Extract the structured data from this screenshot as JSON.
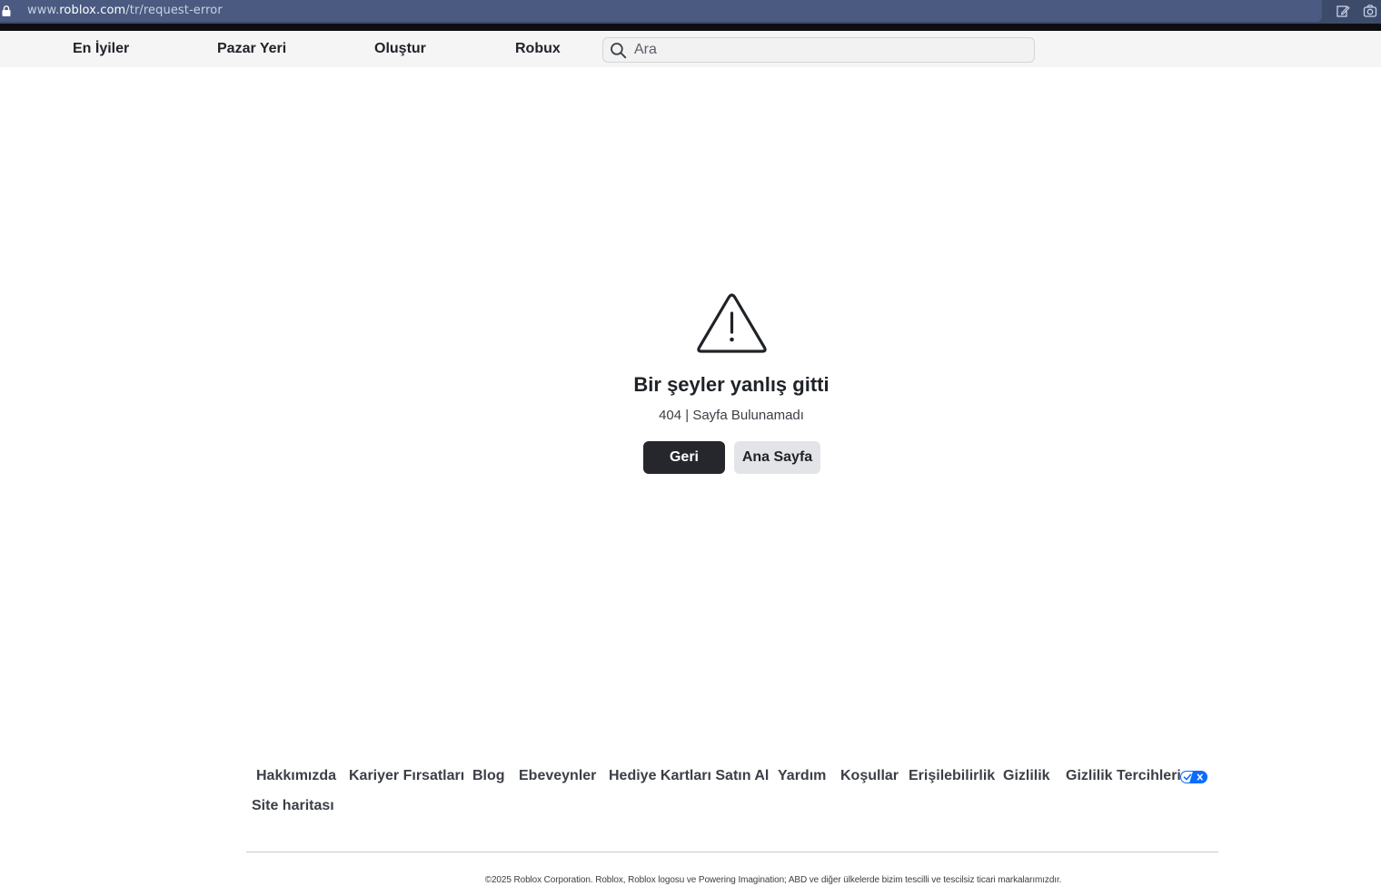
{
  "browser": {
    "url_prefix": "www.",
    "url_domain": "roblox.com",
    "url_path": "/tr/request-error"
  },
  "nav": {
    "items": [
      {
        "label": "En İyiler"
      },
      {
        "label": "Pazar Yeri"
      },
      {
        "label": "Oluştur"
      },
      {
        "label": "Robux"
      }
    ],
    "search_placeholder": "Ara"
  },
  "error": {
    "icon": "warning-triangle-icon",
    "title": "Bir şeyler yanlış gitti",
    "subtitle": "404 | Sayfa Bulunamadı",
    "back_label": "Geri",
    "home_label": "Ana Sayfa"
  },
  "footer": {
    "links": [
      {
        "label": "Hakkımızda"
      },
      {
        "label": "Kariyer Fırsatları"
      },
      {
        "label": "Blog"
      },
      {
        "label": "Ebeveynler"
      },
      {
        "label": "Hediye Kartları Satın Al"
      },
      {
        "label": "Yardım"
      },
      {
        "label": "Koşullar"
      },
      {
        "label": "Erişilebilirlik"
      },
      {
        "label": "Gizlilik"
      },
      {
        "label": "Gizlilik Tercihlerin"
      },
      {
        "label": "Site haritası"
      }
    ],
    "copyright": "©2025 Roblox Corporation. Roblox, Roblox logosu ve Powering Imagination; ABD ve diğer ülkelerde bizim tescilli ve tescilsiz ticari markalarımızdır."
  },
  "colors": {
    "browser_bar": "#3d4b6b",
    "header_bg": "#f5f5f6",
    "primary_button": "#25272c",
    "secondary_button": "#e3e4e8",
    "privacy_toggle": "#0b6cff"
  }
}
